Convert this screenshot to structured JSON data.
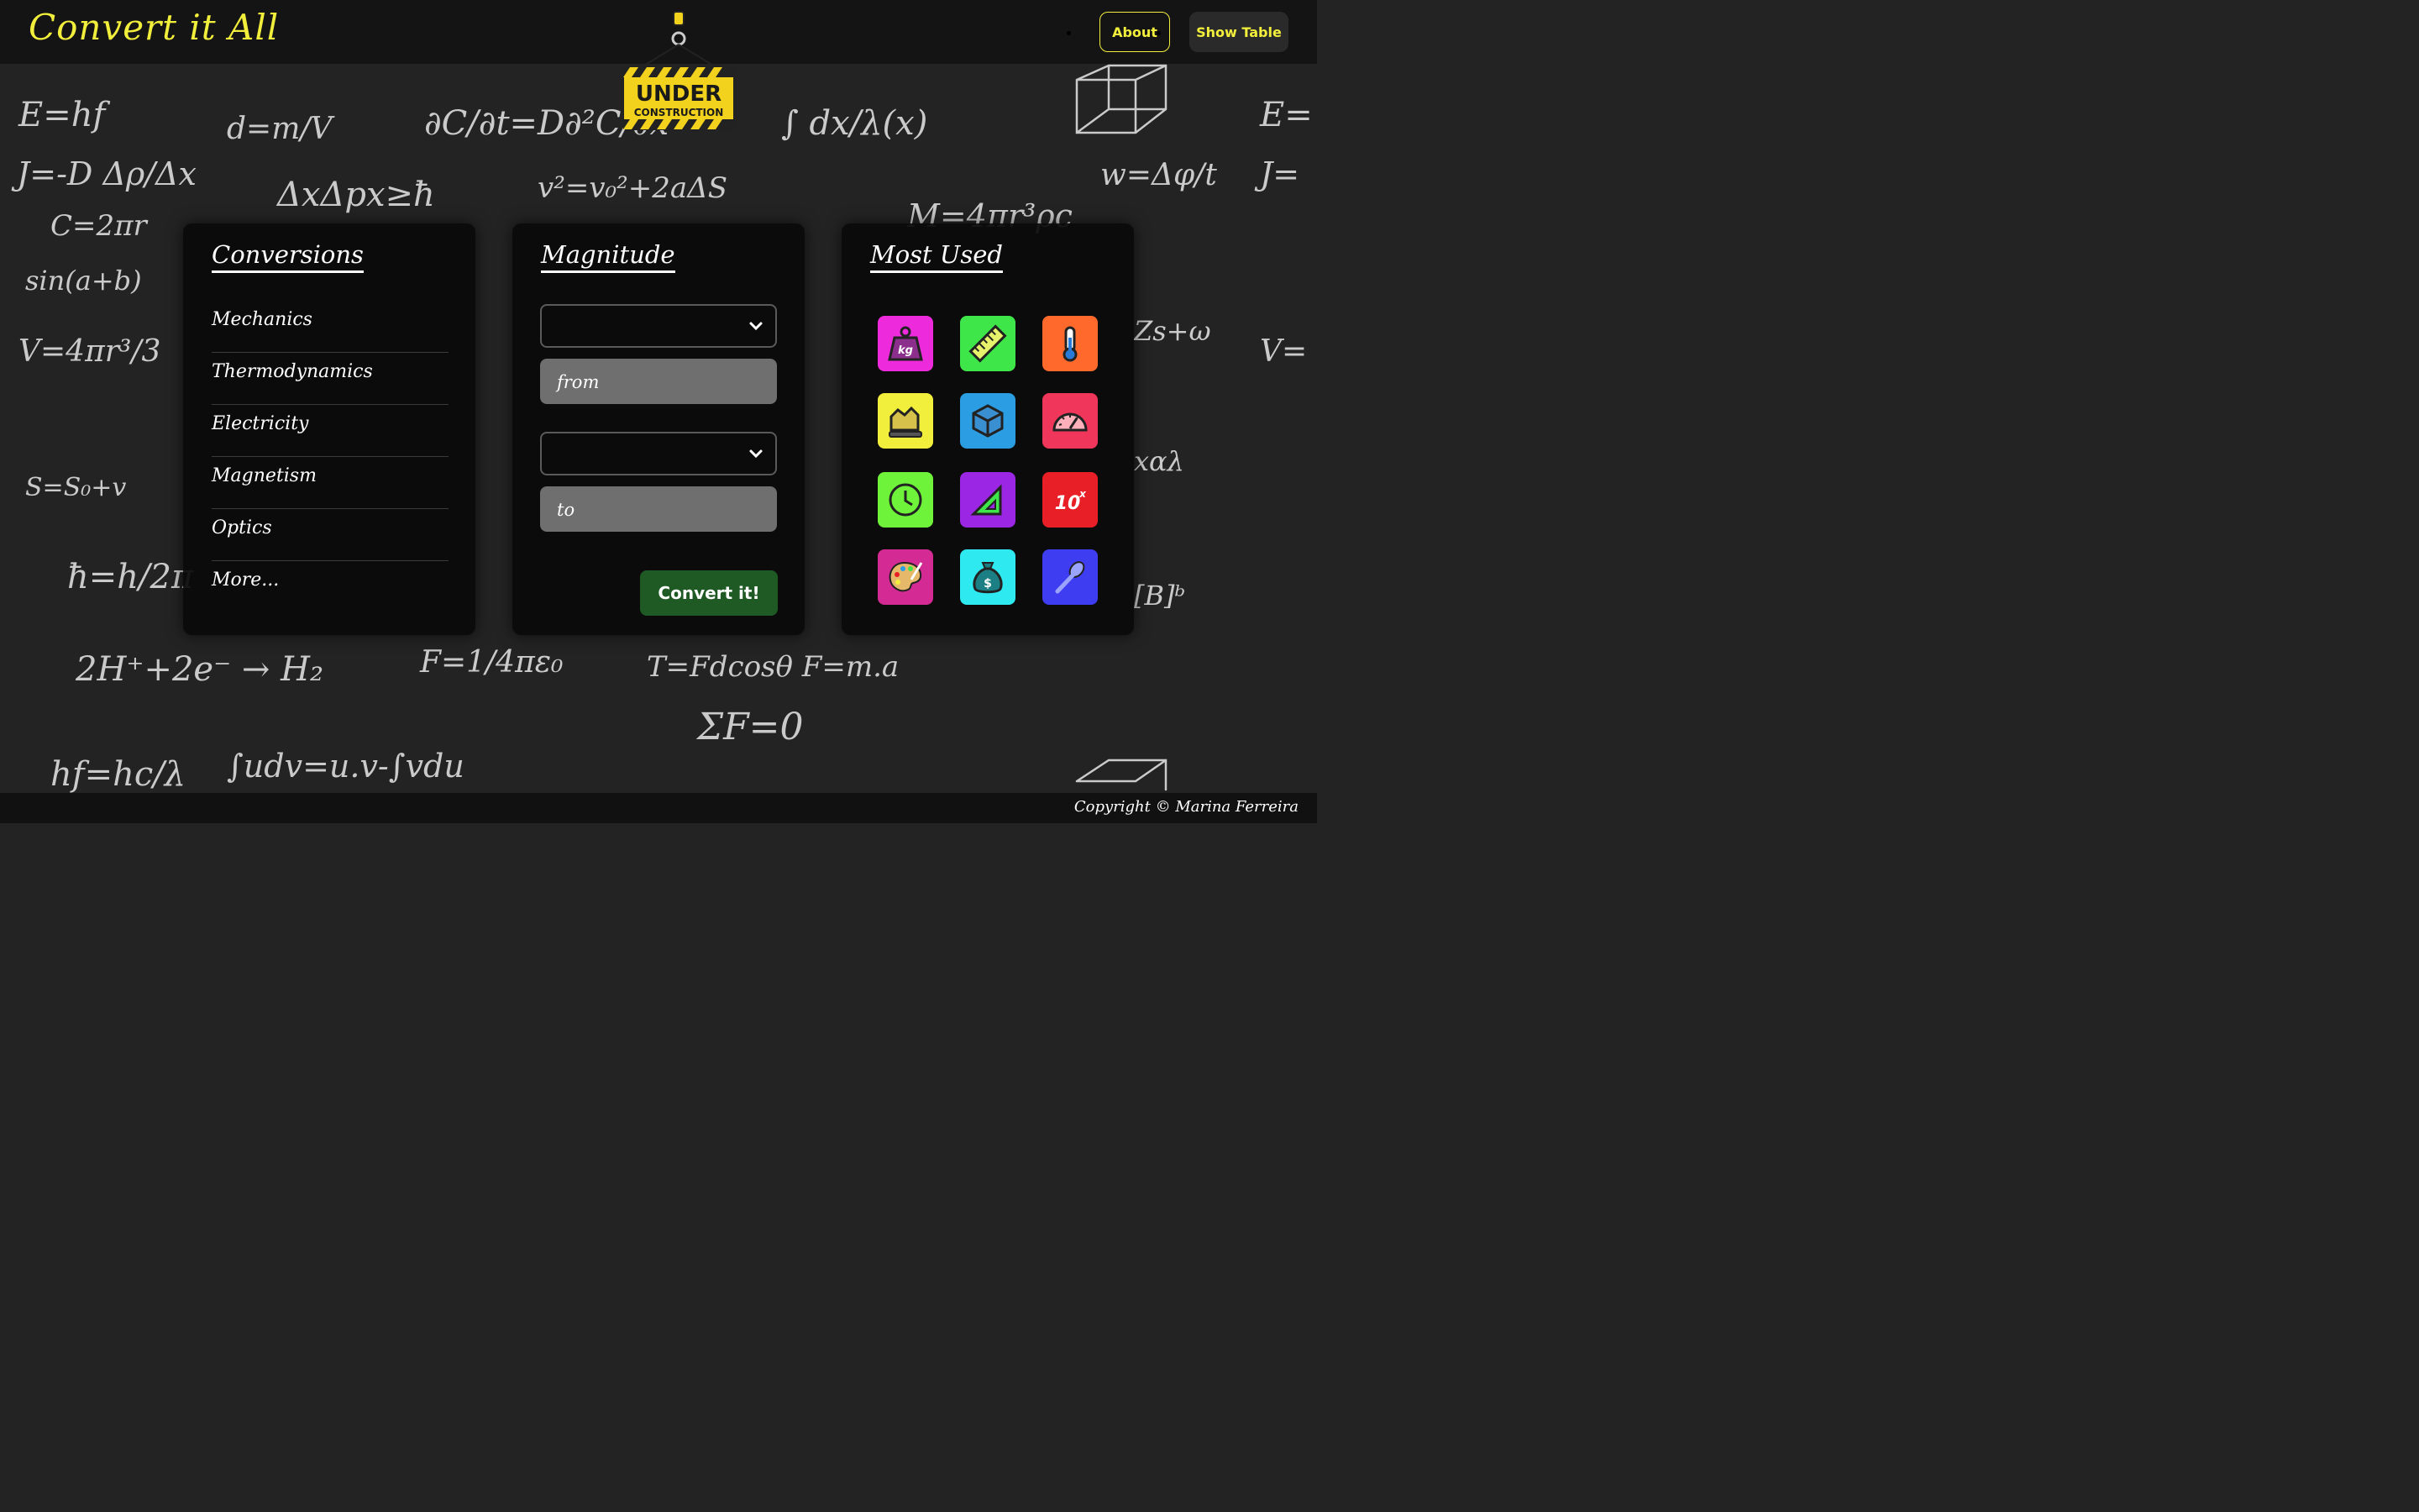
{
  "app": {
    "title": "Convert it All"
  },
  "nav": {
    "about_label": "About",
    "table_label": "Show Table"
  },
  "banner": {
    "line1": "UNDER",
    "line2": "CONSTRUCTION"
  },
  "conversions": {
    "title": "Conversions",
    "items": [
      "Mechanics",
      "Thermodynamics",
      "Electricity",
      "Magnetism",
      "Optics",
      "More..."
    ]
  },
  "magnitude": {
    "title": "Magnitude",
    "from_placeholder": "from",
    "to_placeholder": "to",
    "convert_label": "Convert it!"
  },
  "most_used": {
    "title": "Most Used",
    "tiles": [
      {
        "icon": "weight-icon",
        "label": "kg",
        "color": "#ee2bdc"
      },
      {
        "icon": "ruler-icon",
        "color": "#3ee64a"
      },
      {
        "icon": "thermometer-icon",
        "color": "#ff6a2c"
      },
      {
        "icon": "area-icon",
        "color": "#f2ee3c"
      },
      {
        "icon": "cube-icon",
        "color": "#2a9de3"
      },
      {
        "icon": "speedometer-icon",
        "color": "#f0365a"
      },
      {
        "icon": "clock-icon",
        "color": "#6ff23a"
      },
      {
        "icon": "set-square-icon",
        "color": "#9b26e3"
      },
      {
        "icon": "power-of-ten-icon",
        "label": "10",
        "sup": "x",
        "color": "#e81f27"
      },
      {
        "icon": "palette-icon",
        "color": "#d42a93"
      },
      {
        "icon": "money-bag-icon",
        "label": "$",
        "color": "#2ee9f0"
      },
      {
        "icon": "spoon-icon",
        "color": "#3f3df2"
      }
    ]
  },
  "footer": {
    "copyright": "Copyright © Marina Ferreira"
  }
}
